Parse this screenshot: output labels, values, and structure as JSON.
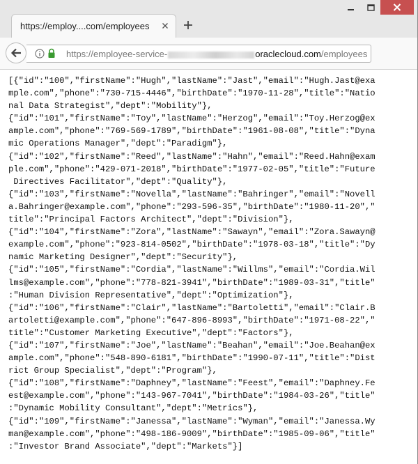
{
  "browser": {
    "tab_title": "https://employ....com/employees",
    "url_prefix": "https://employee-service-",
    "url_host": "oraclecloud.com",
    "url_path": "/employees"
  },
  "json_lines": [
    "[{\"id\":\"100\",\"firstName\":\"Hugh\",\"lastName\":\"Jast\",\"email\":\"Hugh.Jast@exa",
    "mple.com\",\"phone\":\"730-715-4446\",\"birthDate\":\"1970-11-28\",\"title\":\"Natio",
    "nal Data Strategist\",\"dept\":\"Mobility\"},",
    "{\"id\":\"101\",\"firstName\":\"Toy\",\"lastName\":\"Herzog\",\"email\":\"Toy.Herzog@ex",
    "ample.com\",\"phone\":\"769-569-1789\",\"birthDate\":\"1961-08-08\",\"title\":\"Dyna",
    "mic Operations Manager\",\"dept\":\"Paradigm\"},",
    "{\"id\":\"102\",\"firstName\":\"Reed\",\"lastName\":\"Hahn\",\"email\":\"Reed.Hahn@exam",
    "ple.com\",\"phone\":\"429-071-2018\",\"birthDate\":\"1977-02-05\",\"title\":\"Future",
    " Directives Facilitator\",\"dept\":\"Quality\"},",
    "{\"id\":\"103\",\"firstName\":\"Novella\",\"lastName\":\"Bahringer\",\"email\":\"Novell",
    "a.Bahringer@example.com\",\"phone\":\"293-596-35\",\"birthDate\":\"1980-11-20\",\"",
    "title\":\"Principal Factors Architect\",\"dept\":\"Division\"},",
    "{\"id\":\"104\",\"firstName\":\"Zora\",\"lastName\":\"Sawayn\",\"email\":\"Zora.Sawayn@",
    "example.com\",\"phone\":\"923-814-0502\",\"birthDate\":\"1978-03-18\",\"title\":\"Dy",
    "namic Marketing Designer\",\"dept\":\"Security\"},",
    "{\"id\":\"105\",\"firstName\":\"Cordia\",\"lastName\":\"Willms\",\"email\":\"Cordia.Wil",
    "lms@example.com\",\"phone\":\"778-821-3941\",\"birthDate\":\"1989-03-31\",\"title\"",
    ":\"Human Division Representative\",\"dept\":\"Optimization\"},",
    "{\"id\":\"106\",\"firstName\":\"Clair\",\"lastName\":\"Bartoletti\",\"email\":\"Clair.B",
    "artoletti@example.com\",\"phone\":\"647-896-8993\",\"birthDate\":\"1971-08-22\",\"",
    "title\":\"Customer Marketing Executive\",\"dept\":\"Factors\"},",
    "{\"id\":\"107\",\"firstName\":\"Joe\",\"lastName\":\"Beahan\",\"email\":\"Joe.Beahan@ex",
    "ample.com\",\"phone\":\"548-890-6181\",\"birthDate\":\"1990-07-11\",\"title\":\"Dist",
    "rict Group Specialist\",\"dept\":\"Program\"},",
    "{\"id\":\"108\",\"firstName\":\"Daphney\",\"lastName\":\"Feest\",\"email\":\"Daphney.Fe",
    "est@example.com\",\"phone\":\"143-967-7041\",\"birthDate\":\"1984-03-26\",\"title\"",
    ":\"Dynamic Mobility Consultant\",\"dept\":\"Metrics\"},",
    "{\"id\":\"109\",\"firstName\":\"Janessa\",\"lastName\":\"Wyman\",\"email\":\"Janessa.Wy",
    "man@example.com\",\"phone\":\"498-186-9009\",\"birthDate\":\"1985-09-06\",\"title\"",
    ":\"Investor Brand Associate\",\"dept\":\"Markets\"}]"
  ]
}
